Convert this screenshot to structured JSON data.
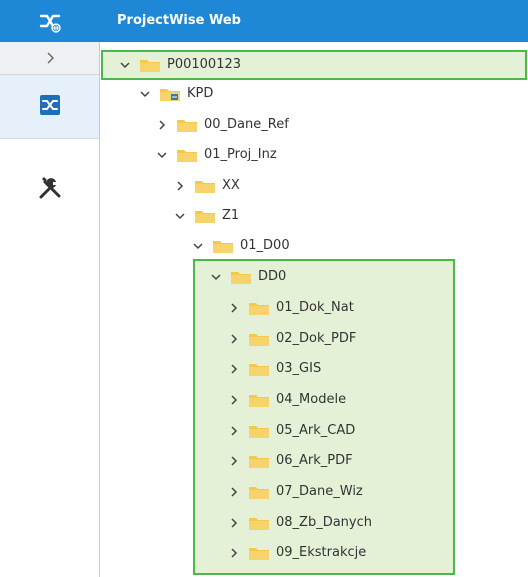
{
  "header": {
    "app_title": "ProjectWise Web",
    "logo_icon": "projectwise-logo-icon"
  },
  "rail": {
    "toggle_icon": "chevron-right-icon",
    "items": [
      {
        "icon": "projectwise-icon",
        "active": true
      },
      {
        "icon": "tools-icon",
        "active": false
      }
    ]
  },
  "tree": {
    "root": {
      "label": "P00100123",
      "expanded": true,
      "icon": "folder-icon"
    },
    "kpd": {
      "label": "KPD",
      "expanded": true,
      "icon": "folder-link-icon"
    },
    "dane_ref": {
      "label": "00_Dane_Ref",
      "expanded": false
    },
    "proj_inz": {
      "label": "01_Proj_Inz",
      "expanded": true
    },
    "xx": {
      "label": "XX",
      "expanded": false
    },
    "z1": {
      "label": "Z1",
      "expanded": true
    },
    "d00": {
      "label": "01_D00",
      "expanded": true
    },
    "dd0": {
      "label": "DD0",
      "expanded": true
    },
    "dd0_children": [
      {
        "label": "01_Dok_Nat"
      },
      {
        "label": "02_Dok_PDF"
      },
      {
        "label": "03_GIS"
      },
      {
        "label": "04_Modele"
      },
      {
        "label": "05_Ark_CAD"
      },
      {
        "label": "06_Ark_PDF"
      },
      {
        "label": "07_Dane_Wiz"
      },
      {
        "label": "08_Zb_Danych"
      },
      {
        "label": "09_Ekstrakcje"
      }
    ]
  },
  "colors": {
    "header_bg": "#1f88d6",
    "highlight_bg": "#e4f1d7",
    "highlight_border": "#4cb84c",
    "folder": "#f3c84d"
  }
}
